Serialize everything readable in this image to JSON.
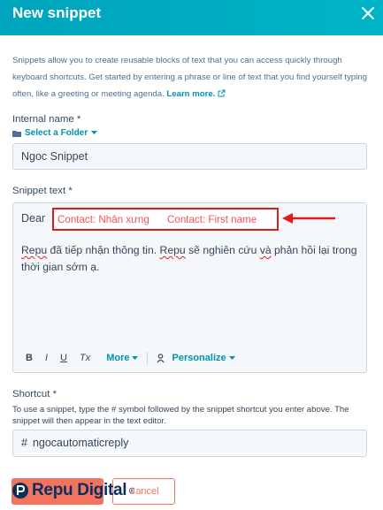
{
  "header": {
    "title": "New snippet",
    "close_icon": "close-icon"
  },
  "intro": {
    "text": "Snippets allow you to create reusable blocks of text that you can access quickly through keyboard shortcuts. Get started by entering a phrase or line of text that you find yourself typing often, like a greeting or meeting agenda.",
    "link": "Learn more."
  },
  "internal_name": {
    "label": "Internal name *",
    "folder_label": "Select a Folder",
    "value": "Ngoc Snippet"
  },
  "snippet_text": {
    "label": "Snippet text *",
    "greeting": "Dear",
    "tokens": [
      "Contact: Nhân xưng",
      "Contact: First name"
    ],
    "body_words": [
      "Repu",
      "đã tiếp nhận thông tin.",
      "Repu",
      "sẽ nghiên cứu",
      "và",
      "phản hồi lại trong thời gian sớm ạ."
    ],
    "toolbar": {
      "bold": "B",
      "italic": "I",
      "underline": "U",
      "clear": "Tx",
      "more": "More",
      "personalize": "Personalize"
    }
  },
  "shortcut": {
    "label": "Shortcut *",
    "help": "To use a snippet, type the # symbol followed by the snippet shortcut you enter above. The snippet will then appear in the text editor.",
    "prefix": "#",
    "value": "ngocautomaticreply"
  },
  "actions": {
    "cancel": "Cancel"
  },
  "watermark": {
    "text": "Repu Digital",
    "mark": "®"
  },
  "colors": {
    "header": "#00a4bd",
    "link": "#0091ae",
    "token": "#f2545b",
    "annotation": "#e31a1a",
    "primary": "#f2735f"
  }
}
